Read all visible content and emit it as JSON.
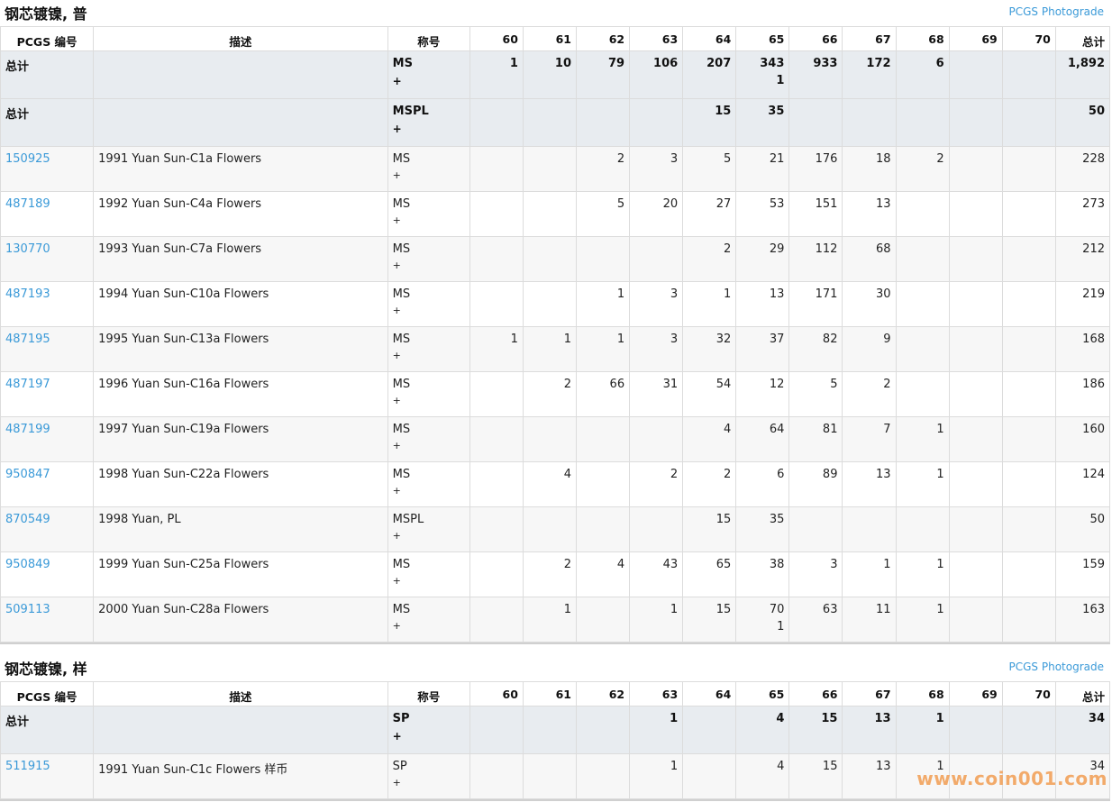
{
  "sections": [
    {
      "title": "钢芯镀镍, 普",
      "photograde": "PCGS Photograde",
      "columns": [
        "PCGS 编号",
        "描述",
        "称号",
        "60",
        "61",
        "62",
        "63",
        "64",
        "65",
        "66",
        "67",
        "68",
        "69",
        "70",
        "总计"
      ],
      "totals": [
        {
          "label": "总计",
          "grade": "MS",
          "plus": "+",
          "values": [
            "1",
            "10",
            "79",
            "106",
            "207",
            "343",
            "933",
            "172",
            "6",
            "",
            ""
          ],
          "plus_values": [
            "",
            "",
            "",
            "",
            "",
            "1",
            "",
            "",
            "",
            "",
            ""
          ],
          "total": "1,892"
        },
        {
          "label": "总计",
          "grade": "MSPL",
          "plus": "+",
          "values": [
            "",
            "",
            "",
            "",
            "15",
            "35",
            "",
            "",
            "",
            "",
            ""
          ],
          "plus_values": [
            "",
            "",
            "",
            "",
            "",
            "",
            "",
            "",
            "",
            "",
            ""
          ],
          "total": "50"
        }
      ],
      "rows": [
        {
          "pcgs": "150925",
          "desc": "1991 Yuan Sun-C1a Flowers",
          "grade": "MS",
          "plus": "+",
          "values": [
            "",
            "",
            "2",
            "3",
            "5",
            "21",
            "176",
            "18",
            "2",
            "",
            ""
          ],
          "plus_values": [
            "",
            "",
            "",
            "",
            "",
            "",
            "",
            "",
            "",
            "",
            ""
          ],
          "total": "228"
        },
        {
          "pcgs": "487189",
          "desc": "1992 Yuan Sun-C4a Flowers",
          "grade": "MS",
          "plus": "+",
          "values": [
            "",
            "",
            "5",
            "20",
            "27",
            "53",
            "151",
            "13",
            "",
            "",
            ""
          ],
          "plus_values": [
            "",
            "",
            "",
            "",
            "",
            "",
            "",
            "",
            "",
            "",
            ""
          ],
          "total": "273"
        },
        {
          "pcgs": "130770",
          "desc": "1993 Yuan Sun-C7a Flowers",
          "grade": "MS",
          "plus": "+",
          "values": [
            "",
            "",
            "",
            "",
            "2",
            "29",
            "112",
            "68",
            "",
            "",
            ""
          ],
          "plus_values": [
            "",
            "",
            "",
            "",
            "",
            "",
            "",
            "",
            "",
            "",
            ""
          ],
          "total": "212"
        },
        {
          "pcgs": "487193",
          "desc": "1994 Yuan Sun-C10a Flowers",
          "grade": "MS",
          "plus": "+",
          "values": [
            "",
            "",
            "1",
            "3",
            "1",
            "13",
            "171",
            "30",
            "",
            "",
            ""
          ],
          "plus_values": [
            "",
            "",
            "",
            "",
            "",
            "",
            "",
            "",
            "",
            "",
            ""
          ],
          "total": "219"
        },
        {
          "pcgs": "487195",
          "desc": "1995 Yuan Sun-C13a Flowers",
          "grade": "MS",
          "plus": "+",
          "values": [
            "1",
            "1",
            "1",
            "3",
            "32",
            "37",
            "82",
            "9",
            "",
            "",
            ""
          ],
          "plus_values": [
            "",
            "",
            "",
            "",
            "",
            "",
            "",
            "",
            "",
            "",
            ""
          ],
          "total": "168"
        },
        {
          "pcgs": "487197",
          "desc": "1996 Yuan Sun-C16a Flowers",
          "grade": "MS",
          "plus": "+",
          "values": [
            "",
            "2",
            "66",
            "31",
            "54",
            "12",
            "5",
            "2",
            "",
            "",
            ""
          ],
          "plus_values": [
            "",
            "",
            "",
            "",
            "",
            "",
            "",
            "",
            "",
            "",
            ""
          ],
          "total": "186"
        },
        {
          "pcgs": "487199",
          "desc": "1997 Yuan Sun-C19a Flowers",
          "grade": "MS",
          "plus": "+",
          "values": [
            "",
            "",
            "",
            "",
            "4",
            "64",
            "81",
            "7",
            "1",
            "",
            ""
          ],
          "plus_values": [
            "",
            "",
            "",
            "",
            "",
            "",
            "",
            "",
            "",
            "",
            ""
          ],
          "total": "160"
        },
        {
          "pcgs": "950847",
          "desc": "1998 Yuan Sun-C22a Flowers",
          "grade": "MS",
          "plus": "+",
          "values": [
            "",
            "4",
            "",
            "2",
            "2",
            "6",
            "89",
            "13",
            "1",
            "",
            ""
          ],
          "plus_values": [
            "",
            "",
            "",
            "",
            "",
            "",
            "",
            "",
            "",
            "",
            ""
          ],
          "total": "124"
        },
        {
          "pcgs": "870549",
          "desc": "1998 Yuan, PL",
          "grade": "MSPL",
          "plus": "+",
          "values": [
            "",
            "",
            "",
            "",
            "15",
            "35",
            "",
            "",
            "",
            "",
            ""
          ],
          "plus_values": [
            "",
            "",
            "",
            "",
            "",
            "",
            "",
            "",
            "",
            "",
            ""
          ],
          "total": "50"
        },
        {
          "pcgs": "950849",
          "desc": "1999 Yuan Sun-C25a Flowers",
          "grade": "MS",
          "plus": "+",
          "values": [
            "",
            "2",
            "4",
            "43",
            "65",
            "38",
            "3",
            "1",
            "1",
            "",
            ""
          ],
          "plus_values": [
            "",
            "",
            "",
            "",
            "",
            "",
            "",
            "",
            "",
            "",
            ""
          ],
          "total": "159"
        },
        {
          "pcgs": "509113",
          "desc": "2000 Yuan Sun-C28a Flowers",
          "grade": "MS",
          "plus": "+",
          "values": [
            "",
            "1",
            "",
            "1",
            "15",
            "70",
            "63",
            "11",
            "1",
            "",
            ""
          ],
          "plus_values": [
            "",
            "",
            "",
            "",
            "",
            "1",
            "",
            "",
            "",
            "",
            ""
          ],
          "total": "163"
        }
      ]
    },
    {
      "title": "钢芯镀镍, 样",
      "photograde": "PCGS Photograde",
      "columns": [
        "PCGS 编号",
        "描述",
        "称号",
        "60",
        "61",
        "62",
        "63",
        "64",
        "65",
        "66",
        "67",
        "68",
        "69",
        "70",
        "总计"
      ],
      "totals": [
        {
          "label": "总计",
          "grade": "SP",
          "plus": "+",
          "values": [
            "",
            "",
            "",
            "1",
            "",
            "4",
            "15",
            "13",
            "1",
            "",
            ""
          ],
          "plus_values": [
            "",
            "",
            "",
            "",
            "",
            "",
            "",
            "",
            "",
            "",
            ""
          ],
          "total": "34"
        }
      ],
      "rows": [
        {
          "pcgs": "511915",
          "desc": "1991 Yuan Sun-C1c Flowers 样币",
          "grade": "SP",
          "plus": "+",
          "values": [
            "",
            "",
            "",
            "1",
            "",
            "4",
            "15",
            "13",
            "1",
            "",
            ""
          ],
          "plus_values": [
            "",
            "",
            "",
            "",
            "",
            "",
            "",
            "",
            "",
            "",
            ""
          ],
          "total": "34"
        }
      ]
    }
  ],
  "watermark": "www.coin001.com",
  "colors": {
    "link": "#3b9ad8",
    "total_row_bg": "#e8ecf0",
    "watermark": "#f2a25b"
  }
}
